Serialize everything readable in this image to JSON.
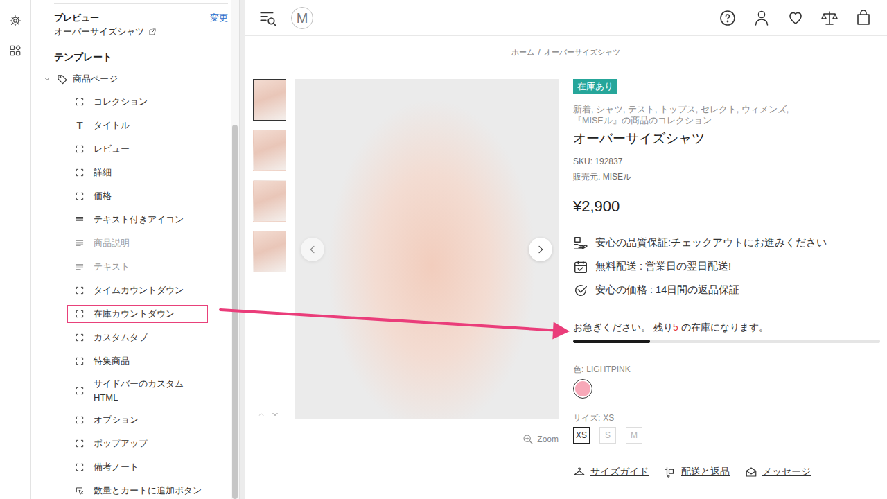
{
  "sidebar": {
    "preview": {
      "label": "プレビュー",
      "change": "変更",
      "page": "オーバーサイズシャツ"
    },
    "template": {
      "label": "テンプレート",
      "root": {
        "label": "商品ページ",
        "expanded": true
      },
      "items": [
        {
          "label": "コレクション",
          "kind": "block",
          "hidden": false,
          "highlighted": false
        },
        {
          "label": "タイトル",
          "kind": "title",
          "icon": "T",
          "hidden": false,
          "highlighted": false
        },
        {
          "label": "レビュー",
          "kind": "block",
          "hidden": false,
          "highlighted": false
        },
        {
          "label": "詳細",
          "kind": "block",
          "hidden": false,
          "highlighted": false
        },
        {
          "label": "価格",
          "kind": "block",
          "hidden": false,
          "highlighted": false
        },
        {
          "label": "テキスト付きアイコン",
          "kind": "text",
          "hidden": false,
          "highlighted": false
        },
        {
          "label": "商品説明",
          "kind": "text",
          "hidden": true,
          "highlighted": false
        },
        {
          "label": "テキスト",
          "kind": "text",
          "hidden": true,
          "highlighted": false
        },
        {
          "label": "タイムカウントダウン",
          "kind": "block",
          "hidden": false,
          "highlighted": false
        },
        {
          "label": "在庫カウントダウン",
          "kind": "block",
          "hidden": false,
          "highlighted": true
        },
        {
          "label": "カスタムタブ",
          "kind": "block",
          "hidden": false,
          "highlighted": false
        },
        {
          "label": "特集商品",
          "kind": "block",
          "hidden": false,
          "highlighted": false
        },
        {
          "label": "サイドバーのカスタムHTML",
          "kind": "block",
          "hidden": false,
          "highlighted": false
        },
        {
          "label": "オプション",
          "kind": "block",
          "hidden": false,
          "highlighted": false
        },
        {
          "label": "ポップアップ",
          "kind": "block",
          "hidden": false,
          "highlighted": false
        },
        {
          "label": "備考ノート",
          "kind": "block",
          "hidden": false,
          "highlighted": false
        },
        {
          "label": "数量とカートに追加ボタン",
          "kind": "buy",
          "hidden": false,
          "highlighted": false
        }
      ]
    }
  },
  "header": {
    "logo": "M"
  },
  "breadcrumb": {
    "items": [
      "ホーム",
      "オーバーサイズシャツ"
    ],
    "separator": "/"
  },
  "gallery": {
    "thumbnails": [
      {
        "selected": true
      },
      {
        "selected": false
      },
      {
        "selected": false
      },
      {
        "selected": false
      }
    ],
    "zoom": "Zoom"
  },
  "product": {
    "badge": "在庫あり",
    "collections": [
      "新着, シャツ, テスト, トップス, セレクト, ウィメンズ,",
      "『MISEル』の商品のコレクション"
    ],
    "title": "オーバーサイズシャツ",
    "sku": "SKU: 192837",
    "vendor": "販売元: MISEル",
    "price": "¥2,900",
    "features": [
      {
        "kind": "quality",
        "text": "安心の品質保証:チェックアウトにお進みください"
      },
      {
        "kind": "shipping",
        "text": "無料配送 : 営業日の翌日配送!"
      },
      {
        "kind": "price",
        "text": "安心の価格 : 14日間の返品保証"
      }
    ],
    "stock": {
      "before": "お急ぎください。 残り",
      "count": "5",
      "after": " の在庫になります。",
      "level": 0.25
    },
    "color": {
      "label": "色:",
      "value": "LIGHTPINK",
      "swatches": [
        {
          "color": "#f7a8b8",
          "selected": true
        }
      ]
    },
    "size": {
      "label": "サイズ:",
      "value": "XS",
      "options": [
        {
          "label": "XS",
          "selected": true,
          "available": true
        },
        {
          "label": "S",
          "selected": false,
          "available": false
        },
        {
          "label": "M",
          "selected": false,
          "available": false
        }
      ]
    },
    "links": [
      {
        "kind": "size",
        "text": "サイズガイド"
      },
      {
        "kind": "shipping",
        "text": "配送と返品"
      },
      {
        "kind": "message",
        "text": "メッセージ"
      }
    ]
  }
}
